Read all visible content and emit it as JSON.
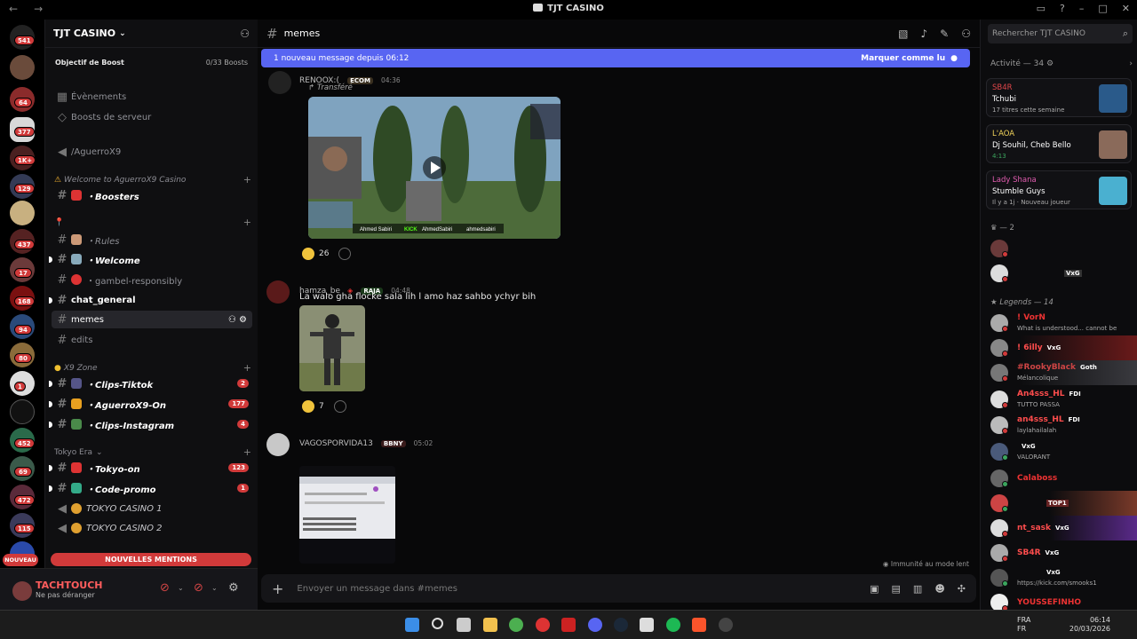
{
  "window": {
    "title": "TJT CASINO"
  },
  "guild_badges": [
    "541",
    "64",
    "377",
    "1K+",
    "129",
    "437",
    "17",
    "168",
    "94",
    "80",
    "1",
    "452",
    "69",
    "472",
    "115"
  ],
  "new_label": "NOUVEAU",
  "sidebar": {
    "server_name": "TJT CASINO",
    "boost_goal": "Objectif de Boost",
    "boost_count": "0/33 Boosts",
    "events": "Évènements",
    "server_boosts": "Boosts de serveur",
    "voice_top": "/AguerroX9",
    "cat1": "Welcome to AguerroX9 Casino",
    "ch_boosters": "・Boosters",
    "cat2": "",
    "ch_rules": "・Rules",
    "ch_welcome": "・Welcome",
    "ch_gamble": "・gambel-responsibly",
    "ch_general": "chat_general",
    "ch_memes": "memes",
    "ch_edits": "edits",
    "cat3": "X9 Zone",
    "ch_clips_tiktok": "・Clips-Tiktok",
    "ch_clips_tiktok_badge": "2",
    "ch_aguerro_on": "・AguerroX9-On",
    "ch_aguerro_on_badge": "177",
    "ch_clips_insta": "・Clips-Instagram",
    "ch_clips_insta_badge": "4",
    "cat4": "Tokyo Era",
    "ch_tokyo_on": "・Tokyo-on",
    "ch_tokyo_on_badge": "123",
    "ch_code_promo": "・Code-promo",
    "ch_code_promo_badge": "1",
    "vc_tokyo1": "TOKYO CASINO 1",
    "vc_tokyo2": "TOKYO CASINO 2",
    "mentions": "NOUVELLES MENTIONS"
  },
  "user": {
    "name": "TACHTOUCH",
    "status": "Ne pas déranger"
  },
  "channel": {
    "name": "memes"
  },
  "banner": {
    "text": "1 nouveau message depuis 06:12",
    "action": "Marquer comme lu"
  },
  "messages": [
    {
      "author": "RENOOX:(",
      "tag": "ECOM",
      "time": "04:36",
      "forwarded": "Transféré",
      "reaction_count": "26",
      "video_captions": [
        "Ahmed Sabiri",
        "KICK",
        "AhmedSabiri",
        "ahmedsabiri"
      ]
    },
    {
      "author": "hamza_be",
      "tag": "RAJA",
      "time": "04:48",
      "text": "La walo gha flocke sala lih l amo haz sahbo ychyr bih",
      "reaction_count": "7"
    },
    {
      "author": "VAGOSPORVIDA13",
      "tag": "BBNY",
      "time": "05:02"
    }
  ],
  "composer": {
    "placeholder": "Envoyer un message dans #memes",
    "immunity": "Immunité au mode lent"
  },
  "right": {
    "search_placeholder": "Rechercher TJT CASINO",
    "activity_title": "Activité — 34",
    "cards": [
      {
        "name": "SB4R",
        "line": "Tchubi",
        "meta": "17 titres cette semaine",
        "color": "#e0464a"
      },
      {
        "name": "L'AOA",
        "line": "Dj Souhil, Cheb Bello",
        "meta": "4:13",
        "color": "#f0d25a"
      },
      {
        "name": "Lady Shana",
        "line": "Stumble Guys",
        "meta": "Il y a 1j · Nouveau joueur",
        "color": "#e25cb0"
      }
    ],
    "group_2": "— 2",
    "group_legends": "Legends — 14",
    "members": [
      {
        "name": "",
        "chip": "",
        "sub": ""
      },
      {
        "name": "",
        "chip": "VxG",
        "sub": ""
      },
      {
        "name": "! VorN",
        "chip": "",
        "sub": "What is understood... cannot be"
      },
      {
        "name": "! 6illy",
        "chip": "VxG",
        "sub": ""
      },
      {
        "name": "#RookyBlack",
        "chip": "Goth",
        "sub": "Mélancolique"
      },
      {
        "name": "An4sss_HL",
        "chip": "FDI",
        "sub": "TUTTO PASSA"
      },
      {
        "name": "an4sss_HL",
        "chip": "FDI",
        "sub": "laylahailalah"
      },
      {
        "name": "",
        "chip": "VxG",
        "sub": "VALORANT"
      },
      {
        "name": "Calaboss",
        "chip": "",
        "sub": ""
      },
      {
        "name": "",
        "chip": "TOP1",
        "sub": ""
      },
      {
        "name": "nt_sask",
        "chip": "VxG",
        "sub": ""
      },
      {
        "name": "SB4R",
        "chip": "VxG",
        "sub": ""
      },
      {
        "name": "",
        "chip": "VxG",
        "sub": "https://kick.com/smooks1"
      },
      {
        "name": "YOUSSEFINHO",
        "chip": "",
        "sub": ""
      }
    ]
  },
  "tray": {
    "lang": "FRA",
    "lang2": "FR",
    "time": "06:14",
    "date": "20/03/2026"
  },
  "colors": {
    "accent": "#5865f2",
    "mention": "#d13a3a",
    "username": "#ff5d5d"
  }
}
